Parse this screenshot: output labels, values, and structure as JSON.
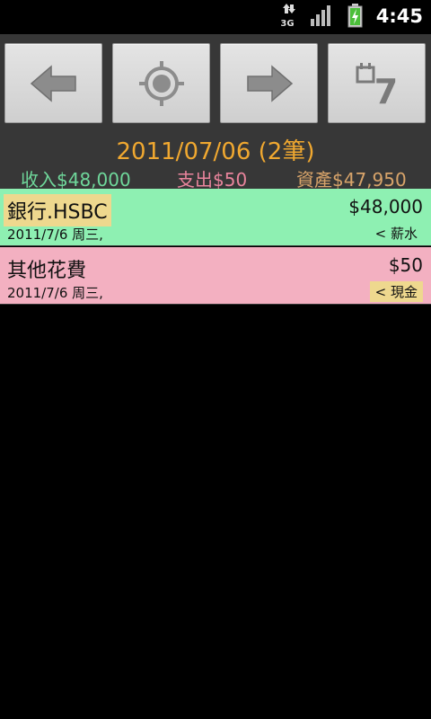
{
  "status_bar": {
    "time": "4:45",
    "network": "3G",
    "icons": [
      "data-transfer-icon",
      "signal-strength-icon",
      "battery-charging-icon"
    ]
  },
  "toolbar": {
    "buttons": [
      {
        "name": "previous-day-button",
        "icon": "left-arrow-icon"
      },
      {
        "name": "today-button",
        "icon": "target-icon"
      },
      {
        "name": "next-day-button",
        "icon": "right-arrow-icon"
      },
      {
        "name": "week-view-button",
        "icon": "calendar-7-icon",
        "label": "7"
      }
    ]
  },
  "header": {
    "date_title": "2011/07/06 (2筆)",
    "income": "收入$48,000",
    "expense": "支出$50",
    "assets": "資產$47,950"
  },
  "colors": {
    "income": "#6fd89b",
    "expense": "#e8849c",
    "assets": "#d8a46a",
    "title": "#f0a830",
    "income_row_bg": "#8ef0b2",
    "expense_row_bg": "#f3b0c1",
    "highlight": "#eed88e"
  },
  "records": [
    {
      "account": "銀行.HSBC",
      "amount": "$48,000",
      "date": "2011/7/6 周三,",
      "category": "< 薪水",
      "type": "income"
    },
    {
      "account": "其他花費",
      "amount": "$50",
      "date": "2011/7/6 周三,",
      "category": "< 現金",
      "type": "expense"
    }
  ]
}
